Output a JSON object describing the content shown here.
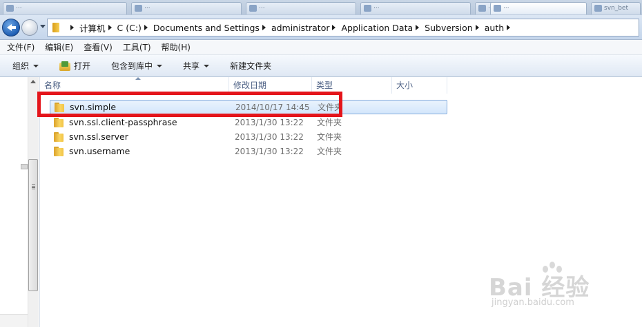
{
  "tabs": [
    {
      "label": "···"
    },
    {
      "label": "···"
    },
    {
      "label": "···"
    },
    {
      "label": "···"
    },
    {
      "label": "···"
    },
    {
      "label": "···"
    },
    {
      "label": "svn_bet"
    }
  ],
  "breadcrumb": [
    "计算机",
    "C (C:)",
    "Documents and Settings",
    "administrator",
    "Application Data",
    "Subversion",
    "auth"
  ],
  "menubar": [
    "文件(F)",
    "编辑(E)",
    "查看(V)",
    "工具(T)",
    "帮助(H)"
  ],
  "commandbar": {
    "organize": "组织",
    "open": "打开",
    "include_library": "包含到库中",
    "share": "共享",
    "new_folder": "新建文件夹"
  },
  "columns": {
    "name": "名称",
    "date": "修改日期",
    "type": "类型",
    "size": "大小"
  },
  "files": [
    {
      "name": "svn.simple",
      "date": "2014/10/17 14:45",
      "type": "文件夹"
    },
    {
      "name": "svn.ssl.client-passphrase",
      "date": "2013/1/30 13:22",
      "type": "文件夹"
    },
    {
      "name": "svn.ssl.server",
      "date": "2013/1/30 13:22",
      "type": "文件夹"
    },
    {
      "name": "svn.username",
      "date": "2013/1/30 13:22",
      "type": "文件夹"
    }
  ],
  "watermark": {
    "brand": "Bai 经验",
    "url": "jingyan.baidu.com"
  },
  "colors": {
    "highlight": "#e4151b",
    "selection": "#d3e6fb"
  }
}
